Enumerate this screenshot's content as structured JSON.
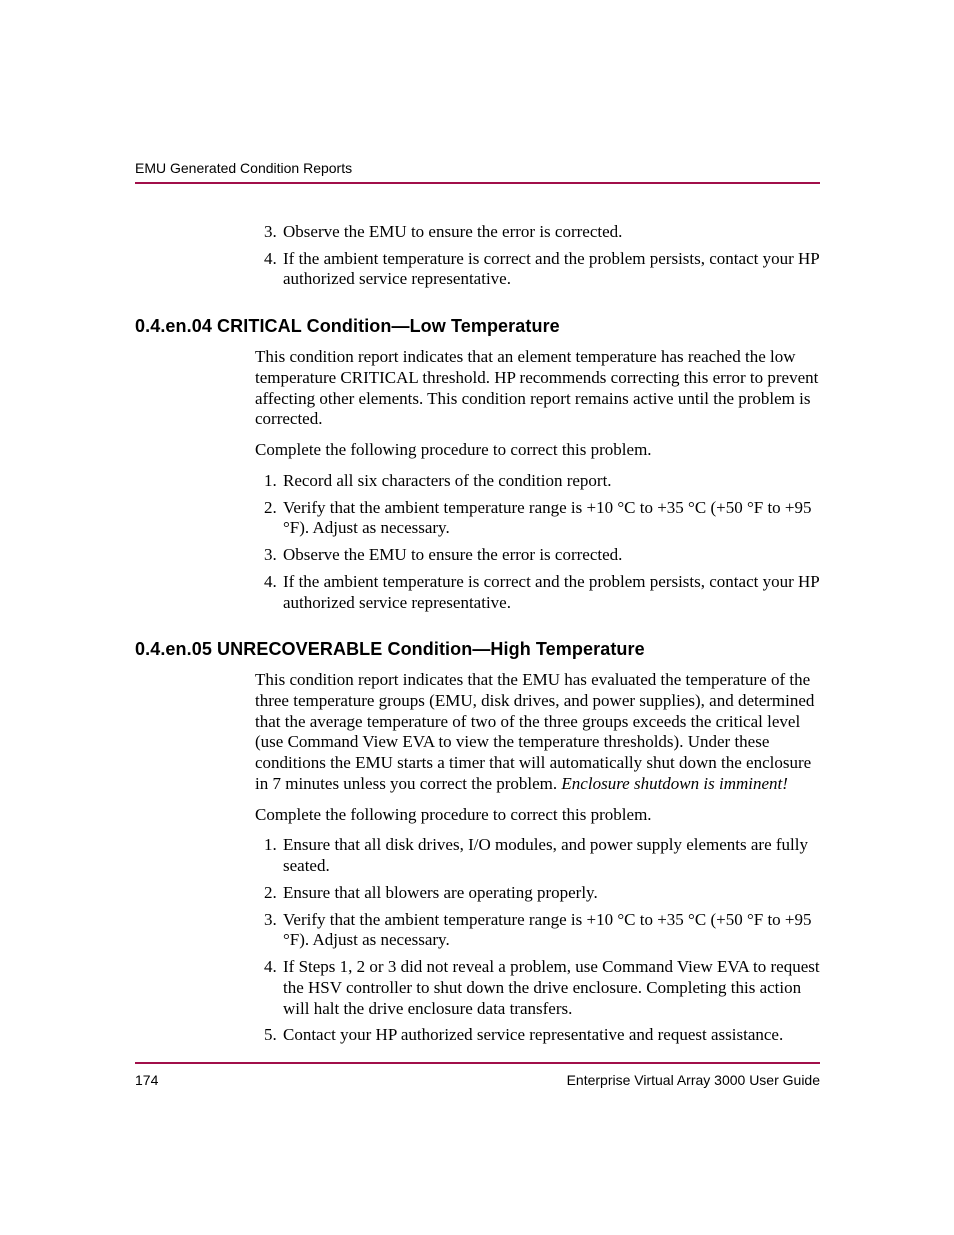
{
  "header": {
    "running_head": "EMU Generated Condition Reports"
  },
  "top_list": {
    "start": 3,
    "items": [
      "Observe the EMU to ensure the error is corrected.",
      "If the ambient temperature is correct and the problem persists, contact your HP authorized service representative."
    ]
  },
  "section1": {
    "heading": "0.4.en.04 CRITICAL Condition—Low Temperature",
    "para1": "This condition report indicates that an element temperature has reached the low temperature CRITICAL threshold. HP recommends correcting this error to prevent affecting other elements. This condition report remains active until the problem is corrected.",
    "para2": "Complete the following procedure to correct this problem.",
    "list": [
      "Record all six characters of the condition report.",
      "Verify that the ambient temperature range is +10 °C to +35 °C (+50 °F to +95 °F). Adjust as necessary.",
      "Observe the EMU to ensure the error is corrected.",
      "If the ambient temperature is correct and the problem persists, contact your HP authorized service representative."
    ]
  },
  "section2": {
    "heading": "0.4.en.05 UNRECOVERABLE Condition—High Temperature",
    "para1_pre": "This condition report indicates that the EMU has evaluated the temperature of the three temperature groups (EMU, disk drives, and power supplies), and determined that the average temperature of two of the three groups exceeds the critical level (use Command View EVA to view the temperature thresholds). Under these conditions the EMU starts a timer that will automatically shut down the enclosure in 7 minutes unless you correct the problem. ",
    "para1_italic": "Enclosure shutdown is imminent!",
    "para2": "Complete the following procedure to correct this problem.",
    "list": [
      "Ensure that all disk drives, I/O modules, and power supply elements are fully seated.",
      "Ensure that all blowers are operating properly.",
      "Verify that the ambient temperature range is +10 °C to +35 °C (+50 °F to +95 °F). Adjust as necessary.",
      "If Steps 1, 2 or 3 did not reveal a problem, use Command View EVA to request the HSV controller to shut down the drive enclosure. Completing this action will halt the drive enclosure data transfers.",
      "Contact your HP authorized service representative and request assistance."
    ]
  },
  "footer": {
    "page_number": "174",
    "doc_title": "Enterprise Virtual Array 3000 User Guide"
  }
}
